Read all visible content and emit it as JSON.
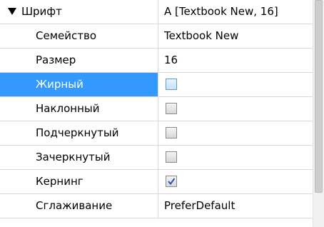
{
  "font_group": {
    "label": "Шрифт",
    "value": "A [Textbook New, 16]"
  },
  "properties": [
    {
      "name": "Семейство",
      "value": "Textbook New"
    },
    {
      "name": "Размер",
      "value": "16"
    },
    {
      "name": "Жирный",
      "checked": false,
      "selected": true
    },
    {
      "name": "Наклонный",
      "checked": false
    },
    {
      "name": "Подчеркнутый",
      "checked": false
    },
    {
      "name": "Зачеркнутый",
      "checked": false
    },
    {
      "name": "Кернинг",
      "checked": true
    },
    {
      "name": "Сглаживание",
      "value": "PreferDefault"
    }
  ],
  "colors": {
    "selection": "#3399ff",
    "grid_line": "#d9d9d9"
  }
}
